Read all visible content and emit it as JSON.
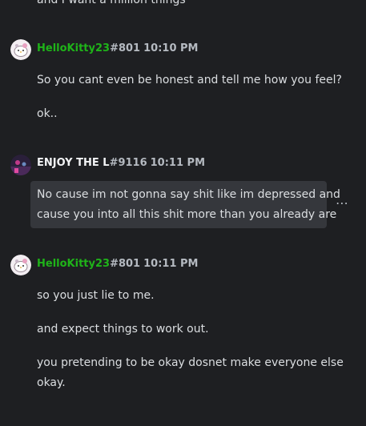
{
  "messages": {
    "top_fragment": "and I want a million things",
    "group1": {
      "username": "HelloKitty23",
      "discriminator": "#801",
      "timestamp": "10:10 PM",
      "lines": [
        "So you cant even be honest and tell me how you feel?",
        "ok.."
      ]
    },
    "group2": {
      "username": "ENJOY THE L",
      "discriminator": "#9116",
      "timestamp": "10:11 PM",
      "lines": [
        "No cause im not gonna say shit like im depressed and",
        "cause you into all this shit more than you already are"
      ],
      "more_glyph": "⋯"
    },
    "group3": {
      "username": "HelloKitty23",
      "discriminator": "#801",
      "timestamp": "10:11 PM",
      "lines": [
        "so you just lie to me.",
        "and expect things to work out.",
        "you pretending to be okay dosnet make everyone else",
        "okay."
      ]
    }
  }
}
